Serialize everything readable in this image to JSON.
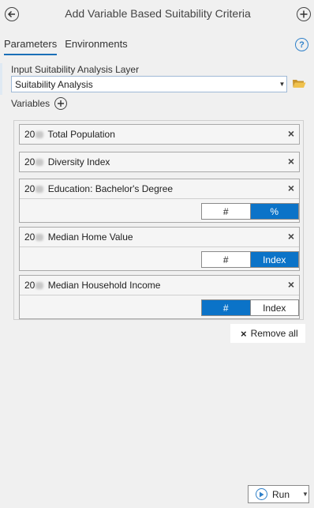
{
  "header": {
    "title": "Add Variable Based Suitability Criteria"
  },
  "tabs": [
    {
      "label": "Parameters",
      "active": true
    },
    {
      "label": "Environments",
      "active": false
    }
  ],
  "help_icon": "?",
  "input_layer": {
    "label": "Input Suitability Analysis Layer",
    "value": "Suitability Analysis"
  },
  "variables": {
    "label": "Variables",
    "items": [
      {
        "prefix": "20",
        "name": "Total Population"
      },
      {
        "prefix": "20",
        "name": "Diversity Index"
      },
      {
        "prefix": "20",
        "name": "Education: Bachelor's Degree",
        "options": [
          "#",
          "%"
        ],
        "selected": "%"
      },
      {
        "prefix": "20",
        "name": "Median Home Value",
        "options": [
          "#",
          "Index"
        ],
        "selected": "Index"
      },
      {
        "prefix": "20",
        "name": "Median Household Income",
        "options": [
          "#",
          "Index"
        ],
        "selected": "#"
      }
    ],
    "remove_icon": "×"
  },
  "remove_all": {
    "icon": "×",
    "label": "Remove all"
  },
  "run": {
    "label": "Run"
  },
  "colors": {
    "accent": "#0b73c8",
    "link": "#1b6fb7",
    "folder": "#e8b64a"
  }
}
